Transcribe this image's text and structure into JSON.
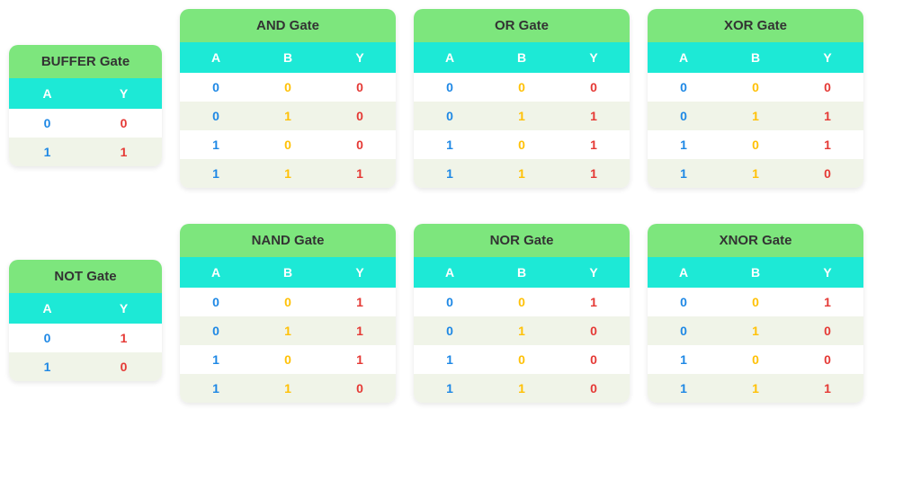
{
  "chart_data": [
    {
      "type": "table",
      "title": "BUFFER Gate",
      "columns": [
        "A",
        "Y"
      ],
      "rows": [
        [
          0,
          0
        ],
        [
          1,
          1
        ]
      ]
    },
    {
      "type": "table",
      "title": "AND Gate",
      "columns": [
        "A",
        "B",
        "Y"
      ],
      "rows": [
        [
          0,
          0,
          0
        ],
        [
          0,
          1,
          0
        ],
        [
          1,
          0,
          0
        ],
        [
          1,
          1,
          1
        ]
      ]
    },
    {
      "type": "table",
      "title": "OR Gate",
      "columns": [
        "A",
        "B",
        "Y"
      ],
      "rows": [
        [
          0,
          0,
          0
        ],
        [
          0,
          1,
          1
        ],
        [
          1,
          0,
          1
        ],
        [
          1,
          1,
          1
        ]
      ]
    },
    {
      "type": "table",
      "title": "XOR Gate",
      "columns": [
        "A",
        "B",
        "Y"
      ],
      "rows": [
        [
          0,
          0,
          0
        ],
        [
          0,
          1,
          1
        ],
        [
          1,
          0,
          1
        ],
        [
          1,
          1,
          0
        ]
      ]
    },
    {
      "type": "table",
      "title": "NOT Gate",
      "columns": [
        "A",
        "Y"
      ],
      "rows": [
        [
          0,
          1
        ],
        [
          1,
          0
        ]
      ]
    },
    {
      "type": "table",
      "title": "NAND Gate",
      "columns": [
        "A",
        "B",
        "Y"
      ],
      "rows": [
        [
          0,
          0,
          1
        ],
        [
          0,
          1,
          1
        ],
        [
          1,
          0,
          1
        ],
        [
          1,
          1,
          0
        ]
      ]
    },
    {
      "type": "table",
      "title": "NOR Gate",
      "columns": [
        "A",
        "B",
        "Y"
      ],
      "rows": [
        [
          0,
          0,
          1
        ],
        [
          0,
          1,
          0
        ],
        [
          1,
          0,
          0
        ],
        [
          1,
          1,
          0
        ]
      ]
    },
    {
      "type": "table",
      "title": "XNOR Gate",
      "columns": [
        "A",
        "B",
        "Y"
      ],
      "rows": [
        [
          0,
          0,
          1
        ],
        [
          0,
          1,
          0
        ],
        [
          1,
          0,
          0
        ],
        [
          1,
          1,
          1
        ]
      ]
    }
  ],
  "layout": [
    [
      0,
      1,
      2,
      3
    ],
    [
      4,
      5,
      6,
      7
    ]
  ]
}
